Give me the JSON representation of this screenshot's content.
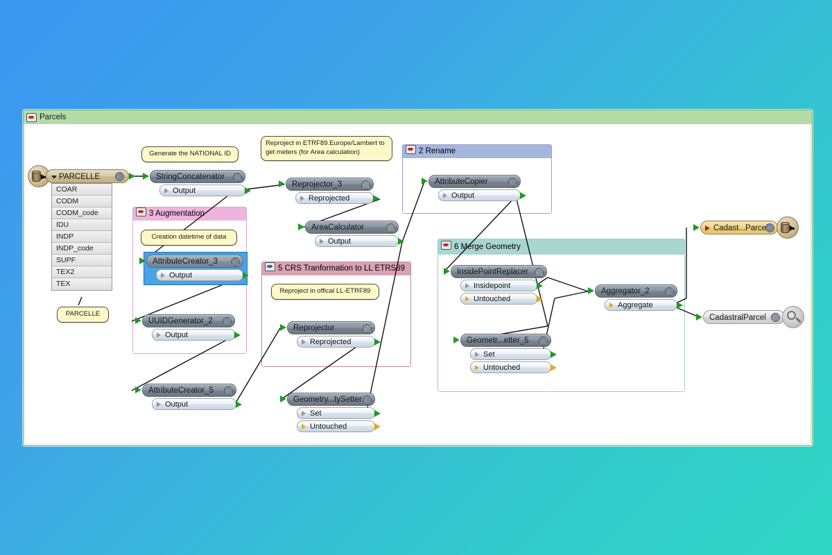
{
  "canvas": {
    "background_top": "#3b96f0",
    "background_bottom": "#2fd6c3"
  },
  "workspace": {
    "bookmark_title": "Parcels",
    "bookmark_color": "#b3dca7"
  },
  "reader": {
    "name": "PARCELLE",
    "icon": "database-icon",
    "attributes": [
      "COAR",
      "CODM",
      "CODM_code",
      "IDU",
      "INDP",
      "INDP_code",
      "SUPF",
      "TEX2",
      "TEX"
    ],
    "feature_type_note": "PARCELLE"
  },
  "annotations": [
    {
      "id": "note-national-id",
      "text": "Generate the NATIONAL ID"
    },
    {
      "id": "note-reproject-lambert",
      "text": "Reproject in ETRF89.Europe/Lambert to get meters (for Area calculation)"
    },
    {
      "id": "note-creation-datetime",
      "text": "Creation datetime of data"
    },
    {
      "id": "note-reproject-official",
      "text": "Reproject in offical LL-ETRF89"
    }
  ],
  "groups": [
    {
      "id": "bm-rename",
      "title": "2 Rename",
      "color": "#a6b6dd",
      "icon": "bookmark-icon"
    },
    {
      "id": "bm-augment",
      "title": "3 Augmentation",
      "color": "#eeb4dd",
      "icon": "bookmark-icon"
    },
    {
      "id": "bm-crs",
      "title": "5 CRS Tranformation  to LL ETRS89",
      "color": "#d8a3b4",
      "icon": "bookmark-icon-blue"
    },
    {
      "id": "bm-merge",
      "title": "6 Merge Geometry",
      "color": "#a9d6d1",
      "icon": "bookmark-icon"
    }
  ],
  "transformers": [
    {
      "id": "string-concatenator",
      "name": "StringConcatenator",
      "gear": "gear-icon",
      "ports": [
        {
          "label": "Output",
          "type": "green"
        }
      ]
    },
    {
      "id": "reprojector-3",
      "name": "Reprojector_3",
      "gear": "gear-icon-gold",
      "ports": [
        {
          "label": "Reprojected",
          "type": "green"
        }
      ]
    },
    {
      "id": "area-calculator",
      "name": "AreaCalculator",
      "gear": "gear-icon-gold",
      "ports": [
        {
          "label": "Output",
          "type": "green"
        }
      ]
    },
    {
      "id": "attribute-copier",
      "name": "AttributeCopier",
      "gear": "gear-icon",
      "ports": [
        {
          "label": "Output",
          "type": "green"
        }
      ]
    },
    {
      "id": "attribute-creator-3",
      "name": "AttributeCreator_3",
      "gear": "gear-icon",
      "ports": [
        {
          "label": "Output",
          "type": "green"
        }
      ],
      "selected": true
    },
    {
      "id": "uuid-generator-2",
      "name": "UUIDGenerator_2",
      "gear": "gear-icon",
      "ports": [
        {
          "label": "Output",
          "type": "green"
        }
      ]
    },
    {
      "id": "attribute-creator-5",
      "name": "AttributeCreator_5",
      "gear": "gear-icon",
      "ports": [
        {
          "label": "Output",
          "type": "green"
        }
      ]
    },
    {
      "id": "reprojector",
      "name": "Reprojector",
      "gear": "gear-icon-gold",
      "ports": [
        {
          "label": "Reprojected",
          "type": "green"
        }
      ]
    },
    {
      "id": "geometry-property-setter",
      "name": "Geometry...tySetter",
      "gear": "gear-icon",
      "ports": [
        {
          "label": "Set",
          "type": "green"
        },
        {
          "label": "Untouched",
          "type": "gold"
        }
      ]
    },
    {
      "id": "inside-point-replacer",
      "name": "InsidePointReplacer",
      "gear": "gear-icon-gold",
      "ports": [
        {
          "label": "Insidepoint",
          "type": "green"
        },
        {
          "label": "Untouched",
          "type": "gold"
        }
      ]
    },
    {
      "id": "geometry-setter-5",
      "name": "Geometr...etter_5",
      "gear": "gear-icon",
      "ports": [
        {
          "label": "Set",
          "type": "green"
        },
        {
          "label": "Untouched",
          "type": "gold"
        }
      ]
    },
    {
      "id": "aggregator-2",
      "name": "Aggregator_2",
      "gear": "gear-icon",
      "ports": [
        {
          "label": "Aggregate",
          "type": "gold"
        }
      ]
    }
  ],
  "outputs": [
    {
      "id": "writer-cadastral-parcel",
      "name": "Cadast...Parcel",
      "kind": "writer",
      "icon": "database-icon",
      "gear": "gear-icon"
    },
    {
      "id": "inspector-cadastral-parcel",
      "name": "CadastralParcel",
      "kind": "inspector",
      "icon": "magnifier-icon",
      "gear": "gear-icon-gold"
    }
  ]
}
